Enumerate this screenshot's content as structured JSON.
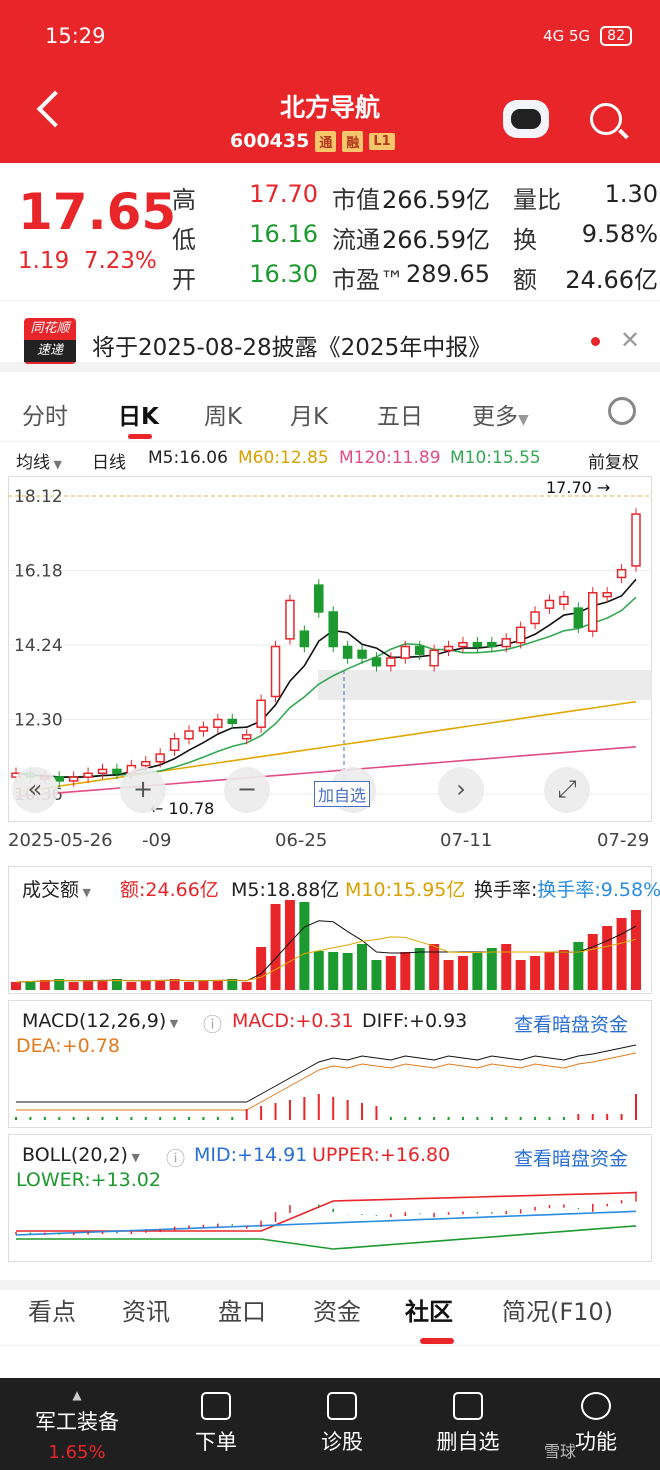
{
  "status": {
    "time": "15:29",
    "network": "4G 5G",
    "battery": "82"
  },
  "header": {
    "title": "北方导航",
    "code": "600435",
    "tags": [
      "通",
      "融",
      "L1"
    ]
  },
  "quote": {
    "price": "17.65",
    "change": "1.19",
    "pct": "7.23%",
    "rows": [
      [
        "高",
        "17.70",
        "市值",
        "266.59亿",
        "量比",
        "1.30"
      ],
      [
        "低",
        "16.16",
        "流通",
        "266.59亿",
        "换",
        "9.58%"
      ],
      [
        "开",
        "16.30",
        "市盈™",
        "289.65",
        "额",
        "24.66亿"
      ]
    ]
  },
  "notice": {
    "logo_top": "同花顺",
    "logo_bottom": "速递",
    "text": "将于2025-08-28披露《2025年中报》"
  },
  "tabs": [
    "分时",
    "日K",
    "周K",
    "月K",
    "五日",
    "更多"
  ],
  "indicators": {
    "ma_label": "均线",
    "period": "日线",
    "m5": "M5:16.06",
    "m60": "M60:12.85",
    "m120": "M120:11.89",
    "m10": "M10:15.55",
    "adjust": "前复权"
  },
  "price_axis": [
    "18.12",
    "16.18",
    "14.24",
    "12.30",
    "10.36"
  ],
  "marks": {
    "high": "17.70",
    "low": "10.78"
  },
  "date_axis": [
    "2025-05-26",
    "-09",
    "06-25",
    "07-11",
    "07-29"
  ],
  "volume": {
    "label": "成交额",
    "amount": "额:24.66亿",
    "m5": "M5:18.88亿",
    "m10": "M10:15.95亿",
    "turnover": "换手率:9.58%"
  },
  "macd": {
    "label": "MACD(12,26,9)",
    "macd": "MACD:+0.31",
    "diff": "DIFF:+0.93",
    "dea": "DEA:+0.78",
    "link": "查看暗盘资金"
  },
  "boll": {
    "label": "BOLL(20,2)",
    "mid": "MID:+14.91",
    "upper": "UPPER:+16.80",
    "lower": "LOWER:+13.02",
    "link": "查看暗盘资金"
  },
  "chart_nav": {
    "add": "加自选"
  },
  "bottom_tabs": [
    "看点",
    "资讯",
    "盘口",
    "资金",
    "社区",
    "简况(F10)"
  ],
  "dock": {
    "sector": "军工装备",
    "sector_pct": "1.65%",
    "items": [
      "下单",
      "诊股",
      "删自选",
      "功能"
    ],
    "watermark": "雪球"
  },
  "colors": {
    "up": "#e8262a",
    "down": "#1d9a2f"
  },
  "chart_data": {
    "type": "candlestick",
    "ylim": [
      10.36,
      18.12
    ],
    "x_ticks": [
      "2025-05-26",
      "-09",
      "06-25",
      "07-11",
      "07-29"
    ],
    "candles_approx": [
      [
        10.8,
        10.9
      ],
      [
        10.9,
        10.8
      ],
      [
        10.8,
        10.8
      ],
      [
        10.8,
        10.7
      ],
      [
        10.7,
        10.8
      ],
      [
        10.8,
        10.9
      ],
      [
        10.9,
        11.0
      ],
      [
        11.0,
        10.9
      ],
      [
        10.9,
        11.1
      ],
      [
        11.1,
        11.2
      ],
      [
        11.2,
        11.4
      ],
      [
        11.5,
        11.8
      ],
      [
        11.8,
        12.0
      ],
      [
        12.0,
        12.1
      ],
      [
        12.1,
        12.3
      ],
      [
        12.3,
        12.2
      ],
      [
        11.8,
        11.9
      ],
      [
        12.1,
        12.8
      ],
      [
        12.9,
        14.2
      ],
      [
        14.4,
        15.4
      ],
      [
        14.6,
        14.2
      ],
      [
        15.8,
        15.1
      ],
      [
        15.1,
        14.2
      ],
      [
        14.2,
        13.9
      ],
      [
        14.1,
        13.9
      ],
      [
        13.9,
        13.7
      ],
      [
        13.7,
        13.9
      ],
      [
        13.9,
        14.2
      ],
      [
        14.2,
        14.0
      ],
      [
        13.7,
        14.1
      ],
      [
        14.1,
        14.2
      ],
      [
        14.2,
        14.3
      ],
      [
        14.3,
        14.2
      ],
      [
        14.3,
        14.2
      ],
      [
        14.2,
        14.4
      ],
      [
        14.3,
        14.7
      ],
      [
        14.8,
        15.1
      ],
      [
        15.2,
        15.4
      ],
      [
        15.3,
        15.5
      ],
      [
        15.2,
        14.7
      ],
      [
        14.6,
        15.6
      ],
      [
        15.5,
        15.6
      ],
      [
        16.0,
        16.2
      ],
      [
        16.3,
        17.65
      ]
    ]
  }
}
